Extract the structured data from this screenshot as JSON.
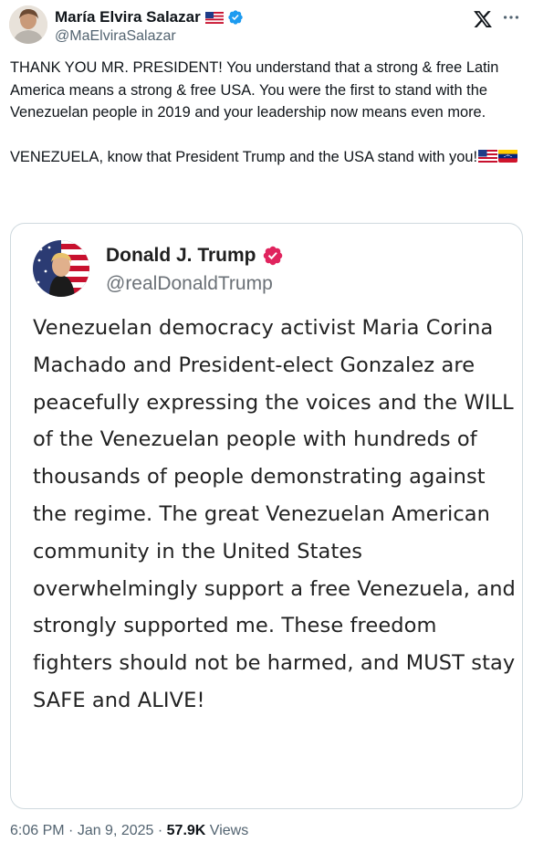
{
  "author": {
    "display_name": "María Elvira Salazar",
    "handle": "@MaElviraSalazar"
  },
  "tweet": {
    "paragraphs": [
      "THANK YOU MR. PRESIDENT! You understand that a strong & free Latin America means a strong & free USA. You were the first to stand with the Venezuelan people in 2019 and your leadership now means even more.",
      "VENEZUELA, know that President Trump and the USA stand with you!"
    ]
  },
  "quoted_post": {
    "display_name": "Donald J. Trump",
    "handle": "@realDonaldTrump",
    "text": "Venezuelan democracy activist Maria Corina Machado and President-elect Gonzalez are peacefully expressing the voices and the WILL of the Venezuelan people with hundreds of thousands of people demonstrating against the regime. The great Venezuelan American community in the United States overwhelmingly support a free Venezuela, and strongly supported me. These freedom fighters should not be harmed, and MUST stay SAFE and ALIVE!"
  },
  "meta": {
    "time": "6:06 PM",
    "separator": " · ",
    "date": "Jan 9, 2025",
    "views_count": "57.9K",
    "views_label": " Views"
  },
  "colors": {
    "text": "#0f1419",
    "secondary": "#536471",
    "verified_blue": "#1d9bf0",
    "verified_pink": "#e0245e",
    "border": "#cfd9de"
  },
  "icons": {
    "verified": "verified-badge-icon",
    "x_logo": "x-logo-icon",
    "more": "more-options-icon",
    "us_flag": "us-flag-icon",
    "venezuela_flag": "venezuela-flag-icon"
  }
}
